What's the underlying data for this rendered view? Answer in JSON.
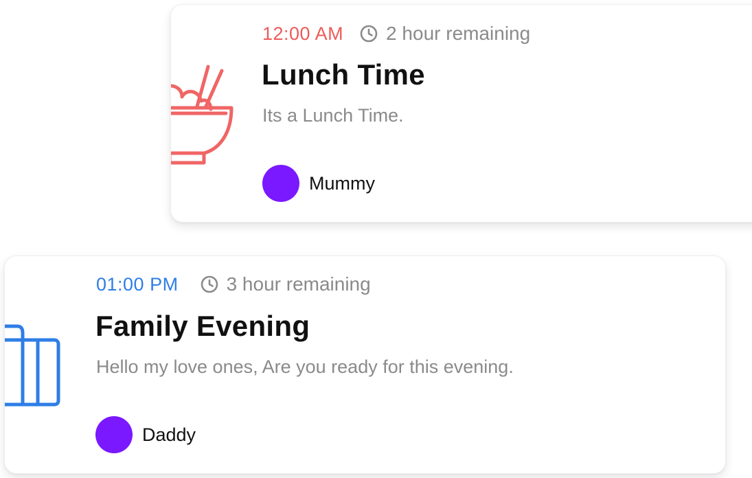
{
  "colors": {
    "lunch_accent": "#ee5a5a",
    "family_accent": "#2f7ee6",
    "avatar": "#7a18ff",
    "muted_text": "#8a8a8a"
  },
  "events": [
    {
      "time": "12:00 AM",
      "remaining": "2 hour remaining",
      "title": "Lunch Time",
      "description": "Its a Lunch Time.",
      "person": "Mummy",
      "icon": "rice-bowl-chopsticks-icon"
    },
    {
      "time": "01:00 PM",
      "remaining": "3 hour remaining",
      "title": "Family Evening",
      "description": "Hello my love ones, Are you ready for this evening.",
      "person": "Daddy",
      "icon": "briefcase-icon"
    }
  ]
}
